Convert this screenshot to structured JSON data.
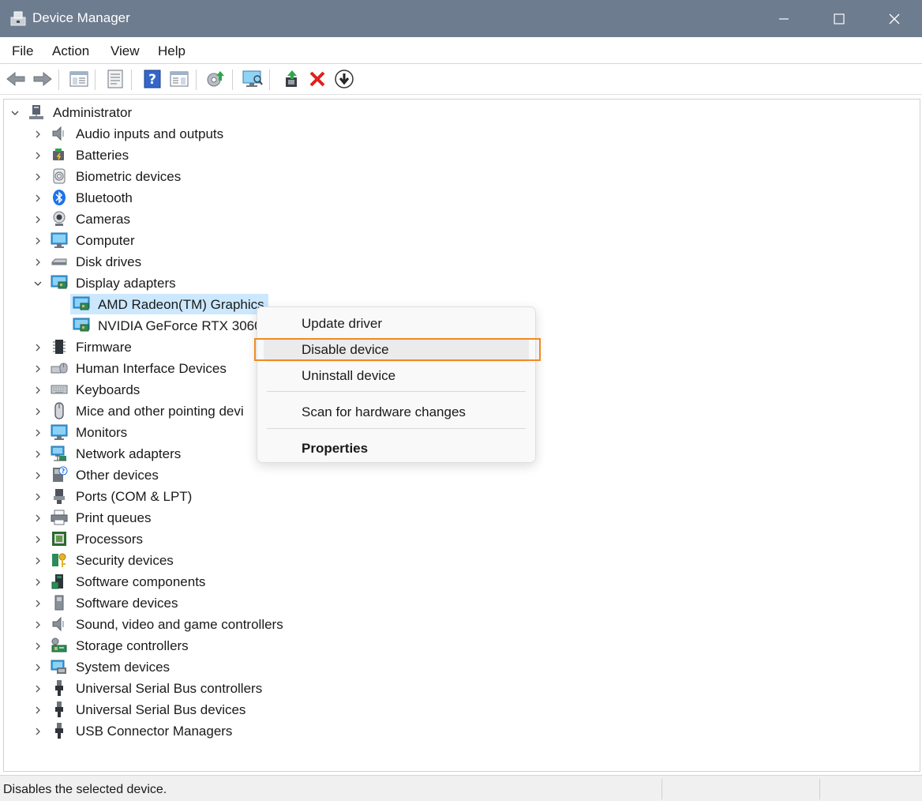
{
  "window": {
    "title": "Device Manager"
  },
  "menu": [
    "File",
    "Action",
    "View",
    "Help"
  ],
  "toolbar_icons": [
    "back-arrow-icon",
    "forward-arrow-icon",
    "show-hide-console-tree-icon",
    "properties-icon",
    "help-icon",
    "action-pane-icon",
    "update-driver-icon",
    "scan-hardware-icon",
    "enable-device-icon",
    "uninstall-device-icon",
    "disable-device-icon"
  ],
  "tree": {
    "root": "Administrator",
    "categories": [
      {
        "label": "Audio inputs and outputs",
        "icon": "speaker-icon",
        "expanded": false
      },
      {
        "label": "Batteries",
        "icon": "battery-icon",
        "expanded": false
      },
      {
        "label": "Biometric devices",
        "icon": "fingerprint-icon",
        "expanded": false
      },
      {
        "label": "Bluetooth",
        "icon": "bluetooth-icon",
        "expanded": false
      },
      {
        "label": "Cameras",
        "icon": "camera-icon",
        "expanded": false
      },
      {
        "label": "Computer",
        "icon": "monitor-icon",
        "expanded": false
      },
      {
        "label": "Disk drives",
        "icon": "disk-drive-icon",
        "expanded": false
      },
      {
        "label": "Display adapters",
        "icon": "display-adapter-icon",
        "expanded": true,
        "children": [
          {
            "label": "AMD Radeon(TM) Graphics",
            "selected": true
          },
          {
            "label": "NVIDIA GeForce RTX 3060",
            "selected": false
          }
        ]
      },
      {
        "label": "Firmware",
        "icon": "firmware-chip-icon",
        "expanded": false
      },
      {
        "label": "Human Interface Devices",
        "icon": "hid-icon",
        "expanded": false
      },
      {
        "label": "Keyboards",
        "icon": "keyboard-icon",
        "expanded": false
      },
      {
        "label": "Mice and other pointing devi",
        "icon": "mouse-icon",
        "expanded": false
      },
      {
        "label": "Monitors",
        "icon": "monitor-icon",
        "expanded": false
      },
      {
        "label": "Network adapters",
        "icon": "network-adapter-icon",
        "expanded": false
      },
      {
        "label": "Other devices",
        "icon": "unknown-device-icon",
        "expanded": false
      },
      {
        "label": "Ports (COM & LPT)",
        "icon": "port-icon",
        "expanded": false
      },
      {
        "label": "Print queues",
        "icon": "printer-icon",
        "expanded": false
      },
      {
        "label": "Processors",
        "icon": "processor-icon",
        "expanded": false
      },
      {
        "label": "Security devices",
        "icon": "security-key-icon",
        "expanded": false
      },
      {
        "label": "Software components",
        "icon": "software-component-icon",
        "expanded": false
      },
      {
        "label": "Software devices",
        "icon": "software-device-icon",
        "expanded": false
      },
      {
        "label": "Sound, video and game controllers",
        "icon": "speaker-icon",
        "expanded": false
      },
      {
        "label": "Storage controllers",
        "icon": "storage-controller-icon",
        "expanded": false
      },
      {
        "label": "System devices",
        "icon": "system-device-icon",
        "expanded": false
      },
      {
        "label": "Universal Serial Bus controllers",
        "icon": "usb-icon",
        "expanded": false
      },
      {
        "label": "Universal Serial Bus devices",
        "icon": "usb-icon",
        "expanded": false
      },
      {
        "label": "USB Connector Managers",
        "icon": "usb-icon",
        "expanded": false
      }
    ]
  },
  "context_menu": {
    "items": [
      {
        "label": "Update driver"
      },
      {
        "label": "Disable device",
        "hovered": true
      },
      {
        "label": "Uninstall device"
      },
      {
        "label": "Scan for hardware changes"
      },
      {
        "label": "Properties",
        "bold": true
      }
    ]
  },
  "status": {
    "text": "Disables the selected device."
  },
  "colors": {
    "titlebar": "#6d7c8f",
    "selection": "#cce8ff",
    "highlight_box": "#f08a24",
    "delete_red": "#e0201b"
  }
}
